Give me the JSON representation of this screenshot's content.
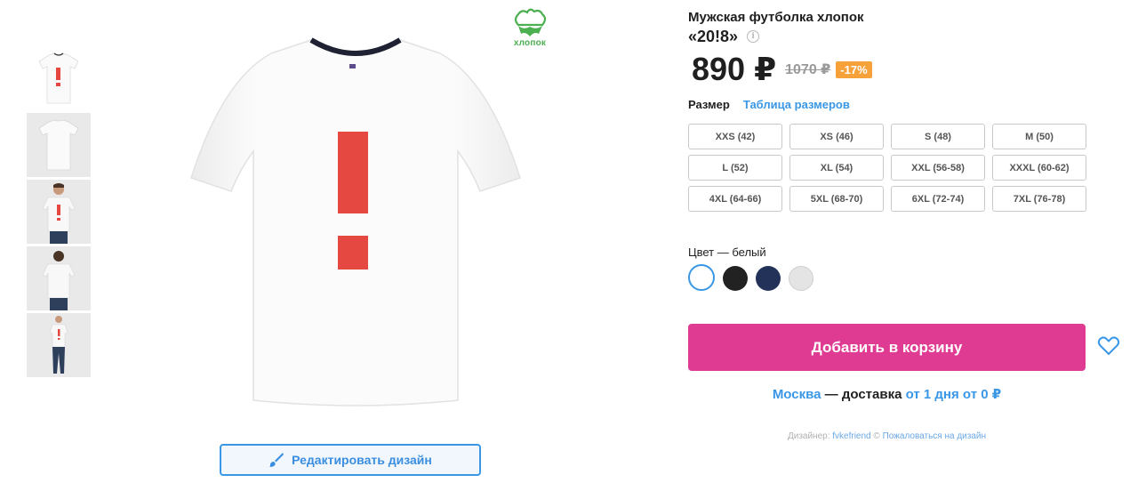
{
  "product": {
    "name": "Мужская футболка хлопок",
    "subtitle": "«20!8»",
    "info_icon": "i",
    "price": "890 ₽",
    "old_price": "1070 ₽",
    "discount": "-17%",
    "badge_text": "хлопок"
  },
  "sizes": {
    "label": "Размер",
    "table_link": "Таблица размеров",
    "options": [
      "XXS (42)",
      "XS (46)",
      "S (48)",
      "M (50)",
      "L (52)",
      "XL (54)",
      "XXL (56-58)",
      "XXXL (60-62)",
      "4XL (64-66)",
      "5XL (68-70)",
      "6XL (72-74)",
      "7XL (76-78)"
    ]
  },
  "color": {
    "label": "Цвет — белый",
    "swatches": [
      {
        "name": "white",
        "hex": "#ffffff",
        "selected": true
      },
      {
        "name": "black",
        "hex": "#222222",
        "selected": false
      },
      {
        "name": "navy",
        "hex": "#233258",
        "selected": false
      },
      {
        "name": "grey",
        "hex": "#e4e4e4",
        "selected": false
      }
    ]
  },
  "actions": {
    "add_to_cart": "Добавить в корзину",
    "edit_design": "Редактировать дизайн"
  },
  "delivery": {
    "city": "Москва",
    "separator": " — доставка ",
    "term": "от 1 дня от 0 ₽"
  },
  "designer": {
    "prefix": "Дизайнер: ",
    "name": "fvkefriend",
    "copyright": " © ",
    "report": "Пожаловаться на дизайн"
  },
  "colors": {
    "accent": "#3a97e6",
    "cart": "#e03b92",
    "discount": "#f7a13a",
    "print": "#e44840"
  }
}
